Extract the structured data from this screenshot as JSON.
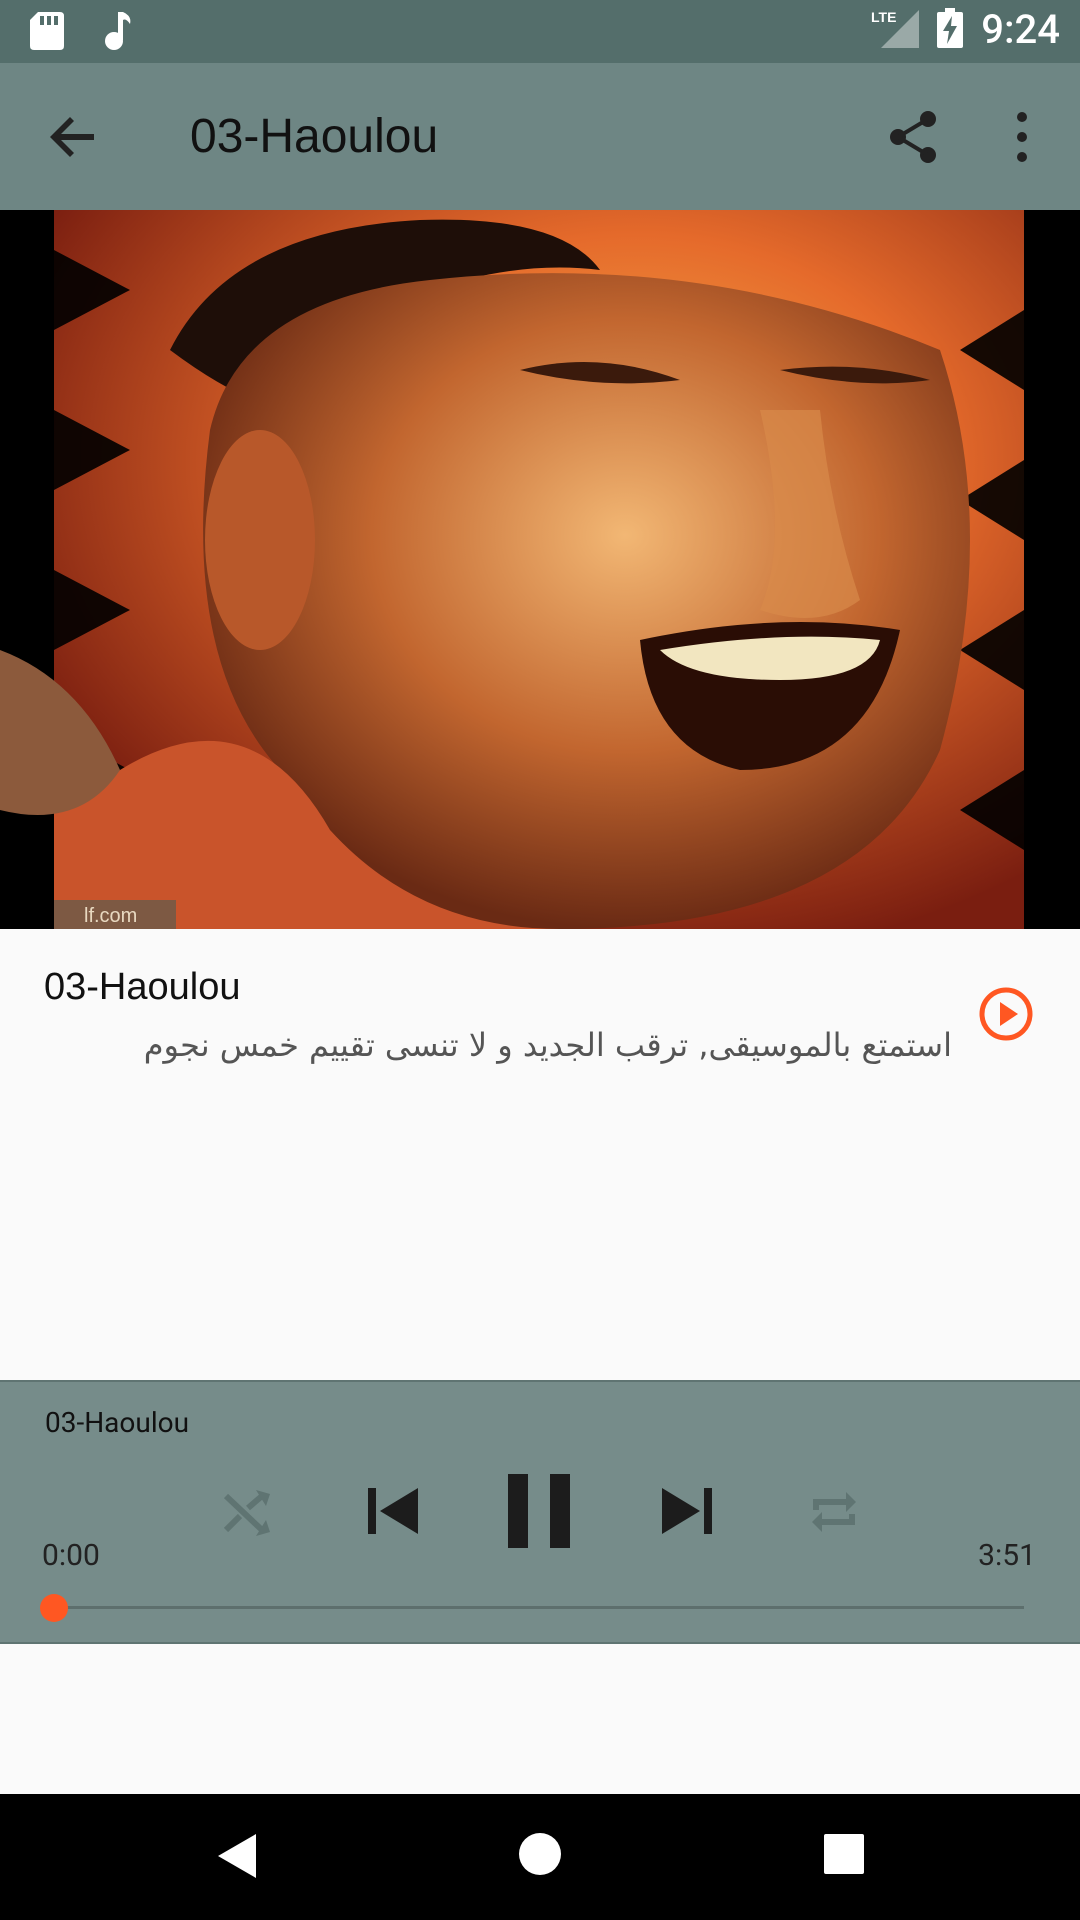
{
  "status_bar": {
    "time": "9:24",
    "network": "LTE"
  },
  "app_bar": {
    "title": "03-Haoulou"
  },
  "hero": {
    "watermark": "lf.com"
  },
  "track_info": {
    "title": "03-Haoulou",
    "description": "استمتع بالموسيقى, ترقب الجديد و لا تنسى تقييم خمس نجوم"
  },
  "player": {
    "title": "03-Haoulou",
    "current_time": "0:00",
    "total_time": "3:51",
    "progress": 0.0
  },
  "colors": {
    "status_bar": "#546e6b",
    "app_bar": "#6e8684",
    "player_bg": "#768c8a",
    "accent": "#ff5722"
  }
}
